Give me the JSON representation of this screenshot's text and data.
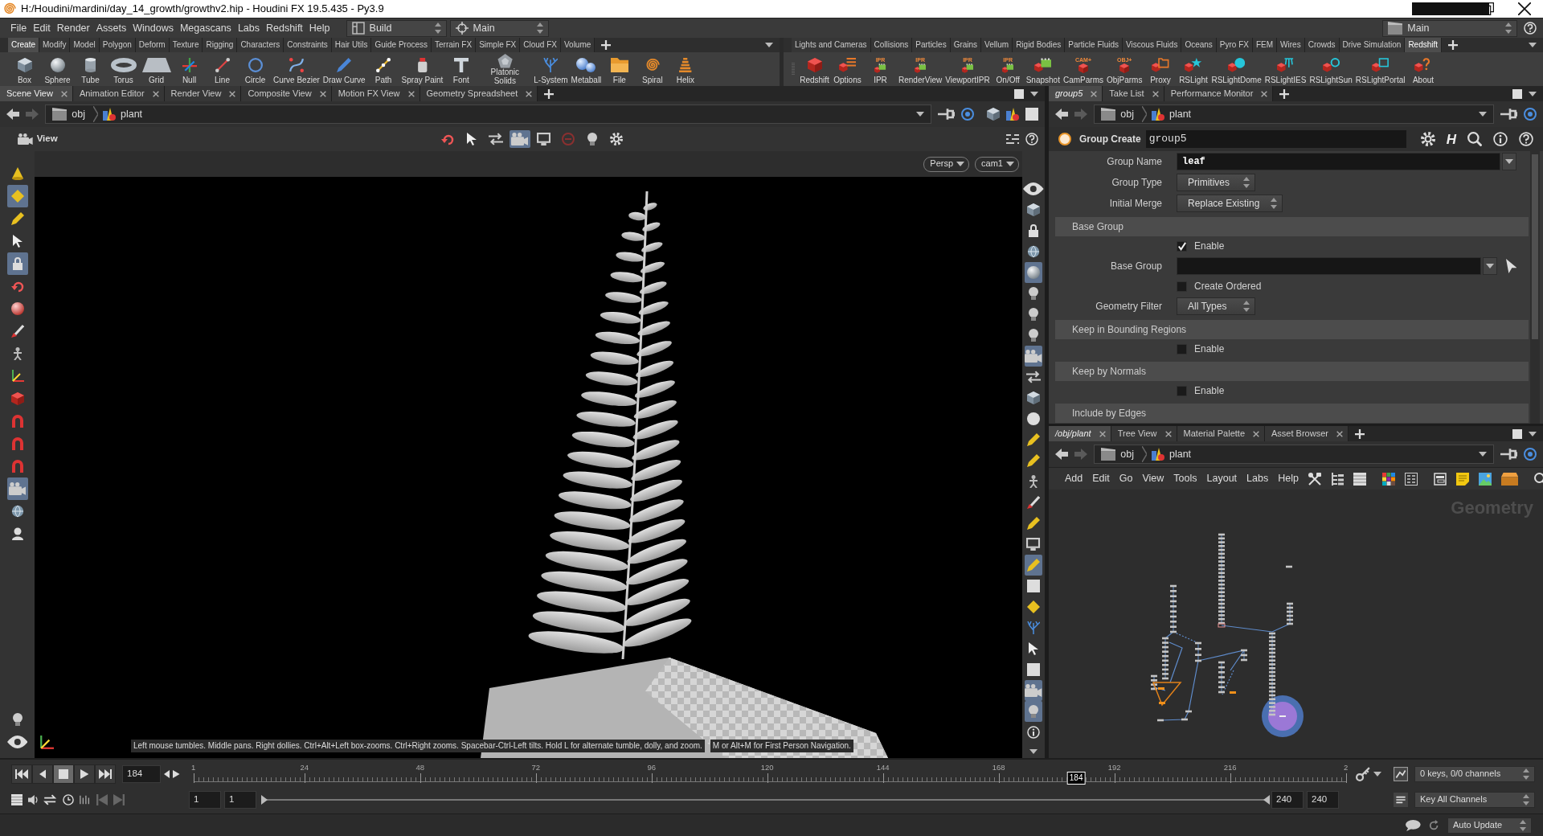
{
  "window": {
    "title": "H:/Houdini/mardini/day_14_growth/growthv2.hip - Houdini FX 19.5.435 - Py3.9"
  },
  "menu_bar": {
    "menus": [
      "File",
      "Edit",
      "Render",
      "Assets",
      "Windows",
      "Megascans",
      "Labs",
      "Redshift",
      "Help"
    ],
    "desktop": "Build",
    "context": "Main",
    "right_menu": "Main"
  },
  "shelves": [
    {
      "tabs": [
        {
          "label": "Create",
          "selected": true
        },
        {
          "label": "Modify",
          "selected": false
        },
        {
          "label": "Model",
          "selected": false
        },
        {
          "label": "Polygon",
          "selected": false
        },
        {
          "label": "Deform",
          "selected": false
        },
        {
          "label": "Texture",
          "selected": false
        },
        {
          "label": "Rigging",
          "selected": false
        },
        {
          "label": "Characters",
          "selected": false
        },
        {
          "label": "Constraints",
          "selected": false
        },
        {
          "label": "Hair Utils",
          "selected": false
        },
        {
          "label": "Guide Process",
          "selected": false
        },
        {
          "label": "Terrain FX",
          "selected": false
        },
        {
          "label": "Simple FX",
          "selected": false
        },
        {
          "label": "Cloud FX",
          "selected": false
        },
        {
          "label": "Volume",
          "selected": false
        }
      ],
      "tools": [
        {
          "label": "Box"
        },
        {
          "label": "Sphere"
        },
        {
          "label": "Tube"
        },
        {
          "label": "Torus"
        },
        {
          "label": "Grid"
        },
        {
          "label": "Null"
        },
        {
          "label": "Line"
        },
        {
          "label": "Circle"
        },
        {
          "label": "Curve Bezier"
        },
        {
          "label": "Draw Curve"
        },
        {
          "label": "Path"
        },
        {
          "label": "Spray Paint"
        },
        {
          "label": "Font"
        },
        {
          "label": "Platonic Solids"
        },
        {
          "label": "L-System"
        },
        {
          "label": "Metaball"
        },
        {
          "label": "File"
        },
        {
          "label": "Spiral"
        },
        {
          "label": "Helix"
        }
      ]
    },
    {
      "tabs": [
        {
          "label": "Lights and Cameras",
          "selected": false
        },
        {
          "label": "Collisions",
          "selected": false
        },
        {
          "label": "Particles",
          "selected": false
        },
        {
          "label": "Grains",
          "selected": false
        },
        {
          "label": "Vellum",
          "selected": false
        },
        {
          "label": "Rigid Bodies",
          "selected": false
        },
        {
          "label": "Particle Fluids",
          "selected": false
        },
        {
          "label": "Viscous Fluids",
          "selected": false
        },
        {
          "label": "Oceans",
          "selected": false
        },
        {
          "label": "Pyro FX",
          "selected": false
        },
        {
          "label": "FEM",
          "selected": false
        },
        {
          "label": "Wires",
          "selected": false
        },
        {
          "label": "Crowds",
          "selected": false
        },
        {
          "label": "Drive Simulation",
          "selected": false
        },
        {
          "label": "Redshift",
          "selected": true
        }
      ],
      "tools": [
        {
          "label": "Redshift"
        },
        {
          "label": "Options"
        },
        {
          "label": "IPR",
          "badge": "IPR"
        },
        {
          "label": "RenderView",
          "badge": "IPR"
        },
        {
          "label": "ViewportIPR",
          "badge": "IPR"
        },
        {
          "label": "On/Off",
          "badge": "IPR"
        },
        {
          "label": "Snapshot"
        },
        {
          "label": "CamParms",
          "badge": "CAM+"
        },
        {
          "label": "ObjParms",
          "badge": "OBJ+"
        },
        {
          "label": "Proxy"
        },
        {
          "label": "RSLight"
        },
        {
          "label": "RSLightDome"
        },
        {
          "label": "RSLightIES"
        },
        {
          "label": "RSLightSun"
        },
        {
          "label": "RSLightPortal"
        },
        {
          "label": "About"
        }
      ]
    }
  ],
  "scene_view": {
    "tabs": [
      {
        "label": "Scene View",
        "selected": true
      },
      {
        "label": "Animation Editor",
        "selected": false
      },
      {
        "label": "Render View",
        "selected": false
      },
      {
        "label": "Composite View",
        "selected": false
      },
      {
        "label": "Motion FX View",
        "selected": false
      },
      {
        "label": "Geometry Spreadsheet",
        "selected": false
      }
    ],
    "path": [
      "obj",
      "plant"
    ],
    "title": "View",
    "view_tools": [
      {
        "selected": false
      },
      {
        "selected": false
      },
      {
        "selected": false
      },
      {
        "selected": true
      },
      {
        "selected": false
      },
      {
        "selected": false
      },
      {
        "selected": false
      },
      {
        "selected": false
      }
    ],
    "left_tools": [
      {
        "selected": false
      },
      {
        "selected": true
      },
      {
        "selected": false
      },
      {
        "selected": false
      },
      {
        "selected": true
      },
      {
        "selected": false
      },
      {
        "selected": false
      },
      {
        "selected": false
      },
      {
        "selected": false
      },
      {
        "selected": false
      },
      {
        "selected": false
      },
      {
        "selected": false
      },
      {
        "selected": false
      },
      {
        "selected": false
      },
      {
        "selected": true
      },
      {
        "selected": false
      },
      {
        "selected": false
      },
      {
        "selected": false
      },
      {
        "selected": false
      }
    ],
    "right_tools": [
      {
        "selected": false
      },
      {
        "selected": false
      },
      {
        "selected": false
      },
      {
        "selected": false
      },
      {
        "selected": true
      },
      {
        "selected": false
      },
      {
        "selected": false
      },
      {
        "selected": false
      },
      {
        "selected": true
      },
      {
        "selected": false
      },
      {
        "selected": false
      },
      {
        "selected": false
      },
      {
        "selected": false
      },
      {
        "selected": false
      },
      {
        "selected": false
      },
      {
        "selected": false
      },
      {
        "selected": false
      },
      {
        "selected": false
      },
      {
        "selected": true
      },
      {
        "selected": false
      },
      {
        "selected": false
      },
      {
        "selected": false
      },
      {
        "selected": false
      },
      {
        "selected": false
      },
      {
        "selected": true
      },
      {
        "selected": true
      },
      {
        "selected": false
      }
    ],
    "projection": "Persp",
    "camera": "cam1",
    "hints": [
      "Left mouse tumbles. Middle pans. Right dollies. Ctrl+Alt+Left box-zooms. Ctrl+Right zooms. Spacebar-Ctrl-Left tilts. Hold L for alternate tumble, dolly, and zoom.",
      "M or Alt+M for First Person Navigation."
    ]
  },
  "parameters": {
    "tabs": [
      {
        "label": "group5",
        "selected": true
      },
      {
        "label": "Take List",
        "selected": false
      },
      {
        "label": "Performance Monitor",
        "selected": false
      }
    ],
    "path": [
      "obj",
      "plant"
    ],
    "node_type": "Group Create",
    "node_name": "group5",
    "asset_button": "H",
    "rows": [
      {
        "kind": "text",
        "label": "Group Name",
        "value": "leaf",
        "picker": false
      },
      {
        "kind": "menu",
        "label": "Group Type",
        "value": "Primitives"
      },
      {
        "kind": "menu",
        "label": "Initial Merge",
        "value": "Replace Existing"
      },
      {
        "kind": "section",
        "label": "Base Group"
      },
      {
        "kind": "toggle",
        "label": "Enable",
        "checked": true
      },
      {
        "kind": "text",
        "label": "Base Group",
        "picker": true
      },
      {
        "kind": "toggle",
        "label": "Create Ordered",
        "checked": false
      },
      {
        "kind": "menu",
        "label": "Geometry Filter",
        "value": "All Types"
      },
      {
        "kind": "section",
        "label": "Keep in Bounding Regions"
      },
      {
        "kind": "toggle",
        "label": "Enable",
        "checked": false
      },
      {
        "kind": "section",
        "label": "Keep by Normals"
      },
      {
        "kind": "toggle",
        "label": "Enable",
        "checked": false
      },
      {
        "kind": "section",
        "label": "Include by Edges"
      }
    ]
  },
  "network": {
    "tabs": [
      {
        "label": "/obj/plant",
        "selected": true
      },
      {
        "label": "Tree View",
        "selected": false
      },
      {
        "label": "Material Palette",
        "selected": false
      },
      {
        "label": "Asset Browser",
        "selected": false
      }
    ],
    "path": [
      "obj",
      "plant"
    ],
    "menus": [
      "Add",
      "Edit",
      "Go",
      "View",
      "Tools",
      "Layout",
      "Labs",
      "Help"
    ],
    "context": "Geometry"
  },
  "timeline": {
    "transport": [
      {
        "selected": false
      },
      {
        "selected": false
      },
      {
        "selected": true
      },
      {
        "selected": false
      },
      {
        "selected": false
      }
    ],
    "frame": "184",
    "ticks": [
      "1",
      "24",
      "48",
      "72",
      "96",
      "120",
      "144",
      "168",
      "192",
      "216",
      "2"
    ],
    "playhead": {
      "label": "184",
      "level": 0.766
    },
    "start": "1",
    "range_start": "1",
    "range_end": "240",
    "end": "240",
    "keys": "0 keys, 0/0 channels",
    "key_mode": "Key All Channels"
  },
  "status_bar": {
    "update_mode": "Auto Update"
  }
}
